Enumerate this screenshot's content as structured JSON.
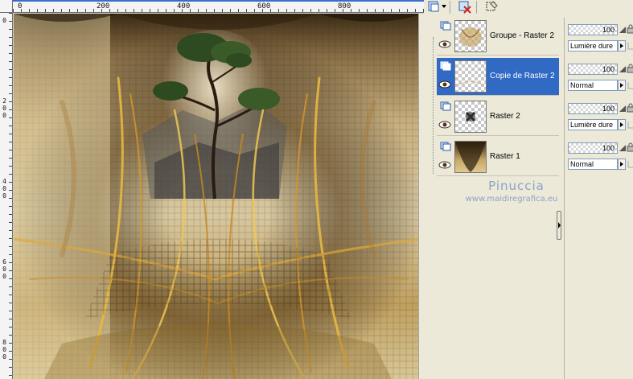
{
  "ruler": {
    "top_labels": [
      "0",
      "200",
      "400",
      "600",
      "800"
    ],
    "left_labels": [
      [
        "0"
      ],
      [
        "2",
        "0",
        "0"
      ],
      [
        "4",
        "0",
        "0"
      ],
      [
        "6",
        "0",
        "0"
      ],
      [
        "8",
        "0",
        "0"
      ]
    ]
  },
  "toolbar": {
    "new_layer_icon": "new-layer-icon",
    "delete_layer_icon": "delete-layer-icon",
    "selection_icon": "selection-icon"
  },
  "layers": [
    {
      "name": "Groupe - Raster 2",
      "opacity": "100",
      "blend": "Lumière dure",
      "selected": false
    },
    {
      "name": "Copie de Raster 2",
      "opacity": "100",
      "blend": "Normal",
      "selected": true
    },
    {
      "name": "Raster 2",
      "opacity": "100",
      "blend": "Lumière dure",
      "selected": false
    },
    {
      "name": "Raster 1",
      "opacity": "100",
      "blend": "Normal",
      "selected": false
    }
  ],
  "watermark": {
    "name": "Pinuccia",
    "url": "www.maidiregrafica.eu"
  },
  "colors": {
    "selection": "#316ac5",
    "gold": "#d8a838",
    "brown": "#4a3818"
  }
}
